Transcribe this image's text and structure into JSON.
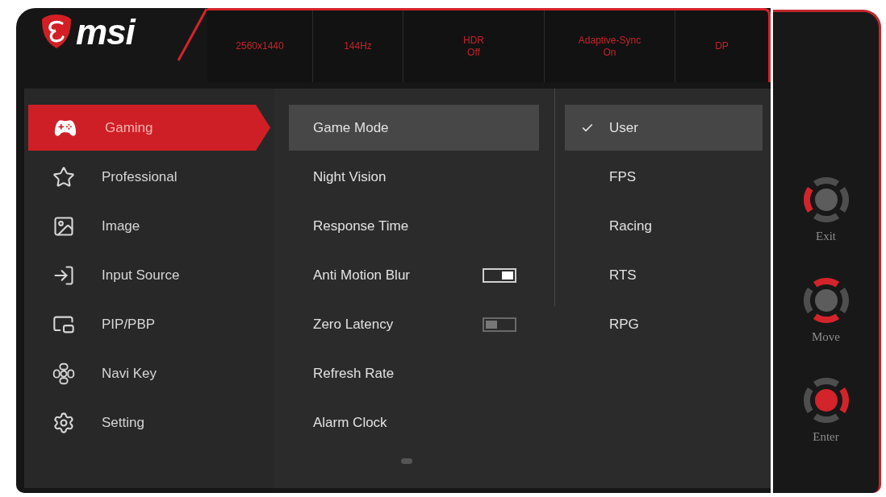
{
  "brand": {
    "name": "msi"
  },
  "status_bar": [
    {
      "label": "2560x1440"
    },
    {
      "label": "144Hz"
    },
    {
      "label": "HDR",
      "value": "Off"
    },
    {
      "label": "Adaptive-Sync",
      "value": "On"
    },
    {
      "label": "DP"
    }
  ],
  "main_menu": [
    {
      "label": "Gaming",
      "selected": true
    },
    {
      "label": "Professional",
      "selected": false
    },
    {
      "label": "Image",
      "selected": false
    },
    {
      "label": "Input Source",
      "selected": false
    },
    {
      "label": "PIP/PBP",
      "selected": false
    },
    {
      "label": "Navi Key",
      "selected": false
    },
    {
      "label": "Setting",
      "selected": false
    }
  ],
  "submenu": [
    {
      "label": "Game Mode",
      "kind": "item",
      "selected": true
    },
    {
      "label": "Night Vision",
      "kind": "item",
      "selected": false
    },
    {
      "label": "Response Time",
      "kind": "item",
      "selected": false
    },
    {
      "label": "Anti Motion Blur",
      "kind": "toggle",
      "selected": false,
      "on": true
    },
    {
      "label": "Zero Latency",
      "kind": "toggle",
      "selected": false,
      "on": false
    },
    {
      "label": "Refresh Rate",
      "kind": "item",
      "selected": false
    },
    {
      "label": "Alarm Clock",
      "kind": "item",
      "selected": false
    }
  ],
  "options": [
    {
      "label": "User",
      "selected": true
    },
    {
      "label": "FPS",
      "selected": false
    },
    {
      "label": "Racing",
      "selected": false
    },
    {
      "label": "RTS",
      "selected": false
    },
    {
      "label": "RPG",
      "selected": false
    }
  ],
  "navi_keys": [
    {
      "label": "Exit",
      "up": false,
      "right": false,
      "down": false,
      "left": true,
      "center": false
    },
    {
      "label": "Move",
      "up": true,
      "right": false,
      "down": true,
      "left": false,
      "center": false
    },
    {
      "label": "Enter",
      "up": false,
      "right": true,
      "down": false,
      "left": false,
      "center": true
    }
  ]
}
